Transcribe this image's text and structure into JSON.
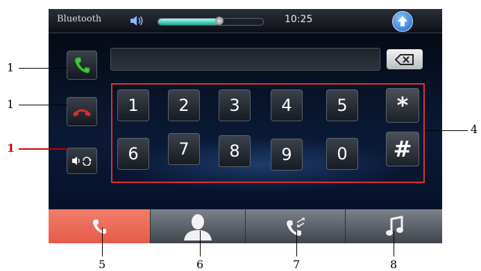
{
  "header": {
    "title": "Bluetooth",
    "volume_icon": "speaker-icon",
    "volume_level_percent": 58,
    "time": "10:25",
    "home_icon": "home-arrow-icon"
  },
  "dialer": {
    "number_value": "",
    "call_icon": "green-phone-icon",
    "hangup_icon": "red-phone-hangup-icon",
    "transfer_icon": "audio-transfer-icon",
    "backspace_icon": "backspace-icon",
    "keys_row1": [
      "1",
      "2",
      "3",
      "4",
      "5",
      "*"
    ],
    "keys_row2": [
      "6",
      "7",
      "8",
      "9",
      "0",
      "#"
    ]
  },
  "tabs": [
    {
      "name": "tab-dialer",
      "icon": "phone-icon",
      "active": true
    },
    {
      "name": "tab-contacts",
      "icon": "contact-person-icon",
      "active": false
    },
    {
      "name": "tab-call-log",
      "icon": "call-log-icon",
      "active": false
    },
    {
      "name": "tab-music",
      "icon": "music-note-icon",
      "active": false
    }
  ],
  "callouts": {
    "left": [
      "1",
      "1",
      "1"
    ],
    "right": "4",
    "bottom": [
      "5",
      "6",
      "7",
      "8"
    ]
  },
  "colors": {
    "accent_tab": "#e55b49",
    "keypad_outline": "#e03030",
    "callout_highlight": "#cc0000"
  }
}
